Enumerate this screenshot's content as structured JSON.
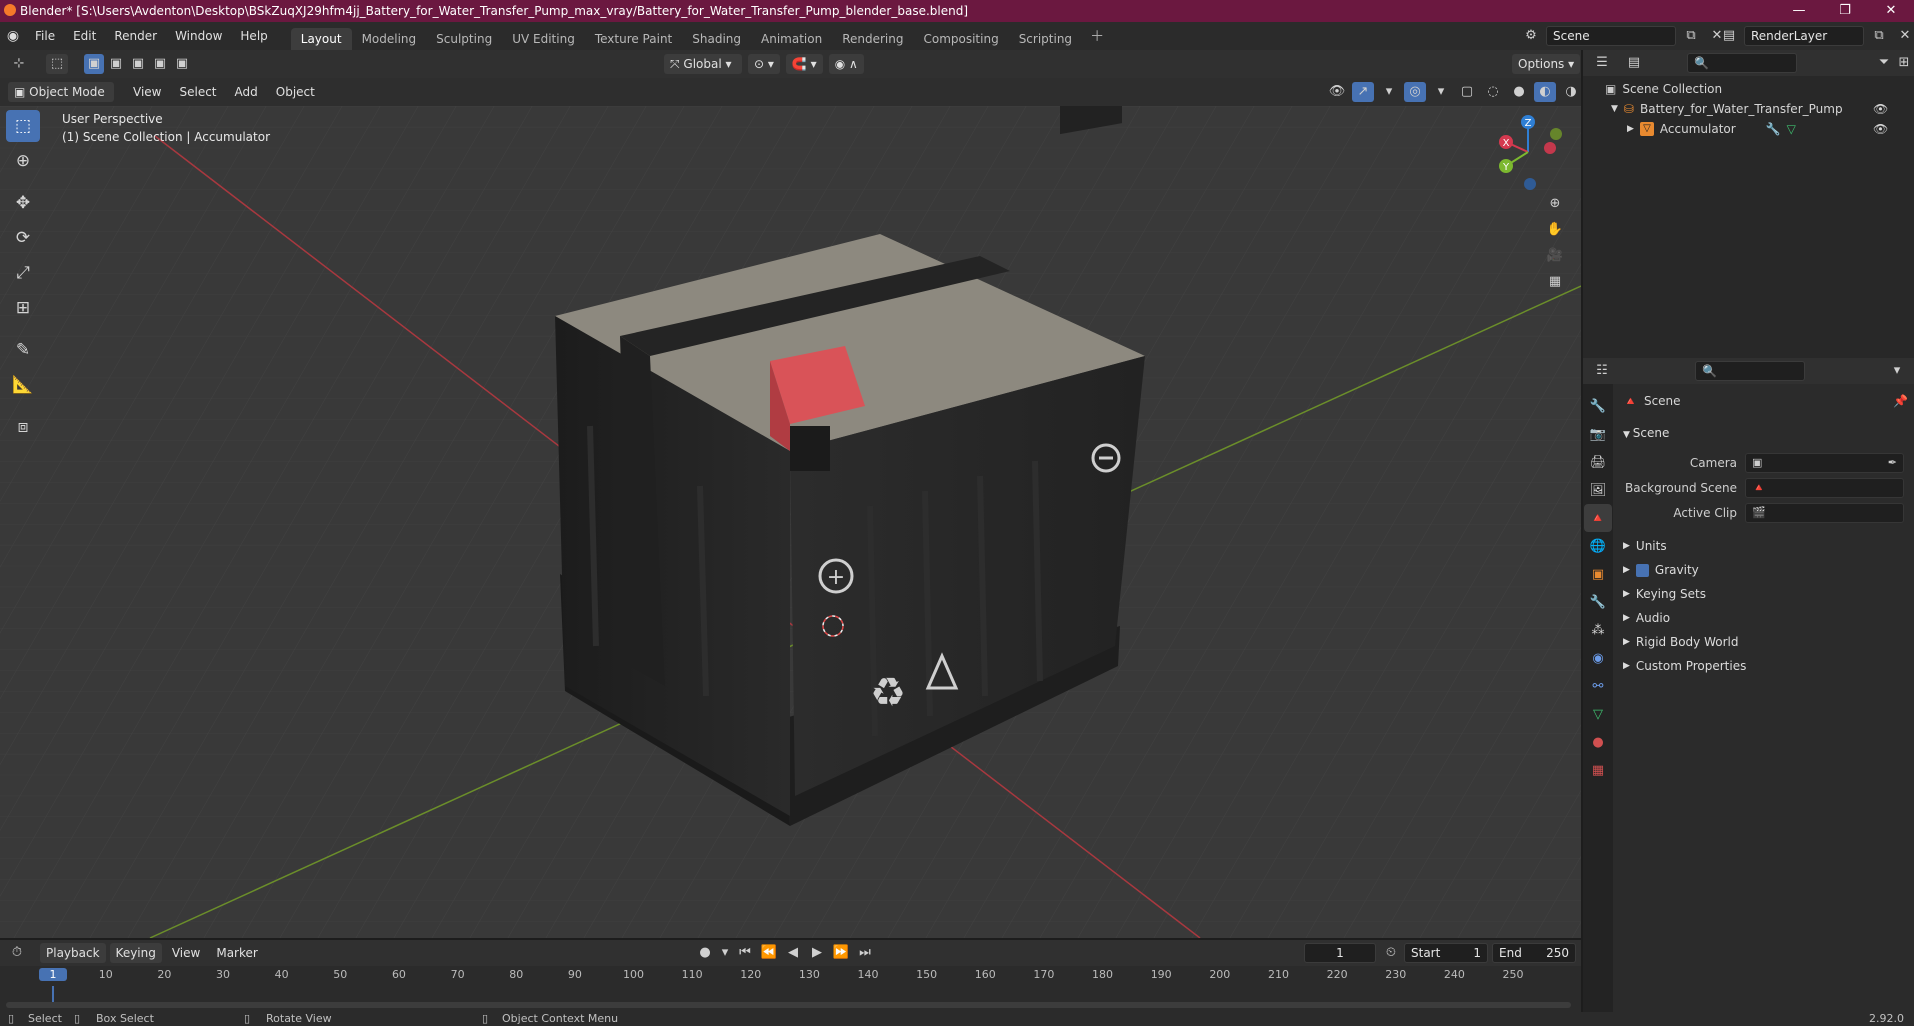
{
  "window": {
    "title": "Blender* [S:\\Users\\Avdenton\\Desktop\\BSkZuqXJ29hfm4jj_Battery_for_Water_Transfer_Pump_max_vray/Battery_for_Water_Transfer_Pump_blender_base.blend]",
    "minimize": "—",
    "maximize": "❐",
    "close": "✕"
  },
  "menu": [
    "File",
    "Edit",
    "Render",
    "Window",
    "Help"
  ],
  "workspaces": [
    "Layout",
    "Modeling",
    "Sculpting",
    "UV Editing",
    "Texture Paint",
    "Shading",
    "Animation",
    "Rendering",
    "Compositing",
    "Scripting"
  ],
  "active_workspace": "Layout",
  "scene_field": "Scene",
  "render_layer_field": "RenderLayer",
  "viewport_header": {
    "transform_orientation": "Global",
    "options_label": "Options",
    "mode": "Object Mode",
    "menus": [
      "View",
      "Select",
      "Add",
      "Object"
    ]
  },
  "viewport": {
    "perspective": "User Perspective",
    "collection_info": "(1) Scene Collection | Accumulator",
    "gizmo": {
      "x": "X",
      "y": "Y",
      "z": "Z"
    }
  },
  "outliner": {
    "root": "Scene Collection",
    "items": [
      {
        "label": "Battery_for_Water_Transfer_Pump"
      },
      {
        "label": "Accumulator"
      }
    ]
  },
  "properties": {
    "context": "Scene",
    "panel_title": "Scene",
    "rows": [
      {
        "label": "Camera"
      },
      {
        "label": "Background Scene"
      },
      {
        "label": "Active Clip"
      }
    ],
    "subpanels": [
      "Units",
      "Gravity",
      "Keying Sets",
      "Audio",
      "Rigid Body World",
      "Custom Properties"
    ]
  },
  "timeline": {
    "menus": [
      "Playback",
      "Keying",
      "View",
      "Marker"
    ],
    "current_frame": "1",
    "start_label": "Start",
    "start_value": "1",
    "end_label": "End",
    "end_value": "250",
    "ruler": [
      "1",
      "10",
      "20",
      "30",
      "40",
      "50",
      "60",
      "70",
      "80",
      "90",
      "100",
      "110",
      "120",
      "130",
      "140",
      "150",
      "160",
      "170",
      "180",
      "190",
      "200",
      "210",
      "220",
      "230",
      "240",
      "250"
    ]
  },
  "statusbar": {
    "select": "Select",
    "box_select": "Box Select",
    "rotate_view": "Rotate View",
    "context_menu": "Object Context Menu",
    "version": "2.92.0"
  },
  "colors": {
    "accent": "#4772b3",
    "title_bar": "#6b1840",
    "x_axis": "#d4394f",
    "y_axis": "#7cb82f",
    "z_axis": "#2f7fd4"
  }
}
